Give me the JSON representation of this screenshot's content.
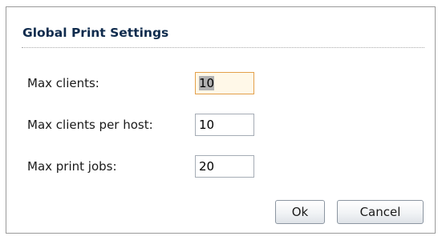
{
  "dialog": {
    "title": "Global Print Settings",
    "fields": [
      {
        "label": "Max clients:",
        "value": "10"
      },
      {
        "label": "Max clients per host:",
        "value": "10"
      },
      {
        "label": "Max print jobs:",
        "value": "20"
      }
    ],
    "ok_label": "Ok",
    "cancel_label": "Cancel"
  },
  "colors": {
    "title_text": "#0f2b4d",
    "focused_border": "#e3a04a",
    "focused_background": "#fff8e8",
    "selection_highlight": "#b2b2b2"
  }
}
